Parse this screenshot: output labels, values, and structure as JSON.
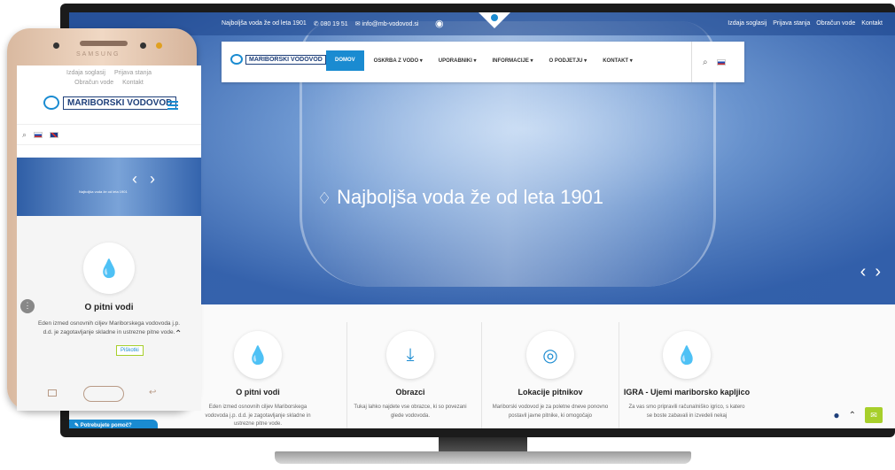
{
  "desktop": {
    "topbar": {
      "tagline": "Najboljša voda že od leta 1901",
      "phone": "080 19 51",
      "email": "info@mb-vodovod.si",
      "links": [
        "Izdaja soglasij",
        "Prijava stanja",
        "Obračun vode",
        "Kontakt"
      ]
    },
    "nav": {
      "logo_text": "MARIBORSKI VODOVOD",
      "items": [
        {
          "label": "DOMOV",
          "active": true
        },
        {
          "label": "OSKRBA Z VODO  ▾",
          "active": false
        },
        {
          "label": "UPORABNIKI  ▾",
          "active": false
        },
        {
          "label": "INFORMACIJE  ▾",
          "active": false
        },
        {
          "label": "O PODJETJU  ▾",
          "active": false
        },
        {
          "label": "KONTAKT  ▾",
          "active": false
        }
      ]
    },
    "hero": {
      "title": "Najboljša voda že od leta 1901"
    },
    "features": [
      {
        "icon": "drops-icon",
        "glyph": "💧",
        "title": "O pitni vodi",
        "desc": "Eden izmed osnovnih ciljev Mariborskega vodovoda j.p. d.d. je zagotavljanje skladne in ustrezne pitne vode."
      },
      {
        "icon": "download-icon",
        "glyph": "⤓",
        "title": "Obrazci",
        "desc": "Tukaj lahko najdete vse obrazce, ki so povezani glede vodovoda."
      },
      {
        "icon": "location-pin-icon",
        "glyph": "◎",
        "title": "Lokacije pitnikov",
        "desc": "Mariborski vodovod je za poletne dneve ponovno postavil javne pitnike, ki omogočajo"
      },
      {
        "icon": "water-drop-icon",
        "glyph": "💧",
        "title": "IGRA - Ujemi mariborsko kapljico",
        "desc": "Za vas smo pripravili računalniško igrico, s katero se boste zabavali in izvedeli nekaj"
      }
    ],
    "help_button": "Potrebujete pomoč?"
  },
  "mobile": {
    "links": [
      "Izdaja soglasij",
      "Prijava stanja",
      "Obračun vode",
      "Kontakt"
    ],
    "logo_text": "MARIBORSKI VODOVOD",
    "brand": "SAMSUNG",
    "hero_text": "Najboljša voda že od leta 1901",
    "section_title": "O pitni vodi",
    "section_desc": "Eden izmed osnovnih ciljev Mariborskega vodovoda j.p. d.d. je zagotavljanje skladne in ustrezne pitne vode.",
    "cookie_label": "Piškotki"
  },
  "colors": {
    "accent": "#1a8bd1",
    "brand_dark": "#1e3f7a",
    "green": "#a7cf2b"
  }
}
